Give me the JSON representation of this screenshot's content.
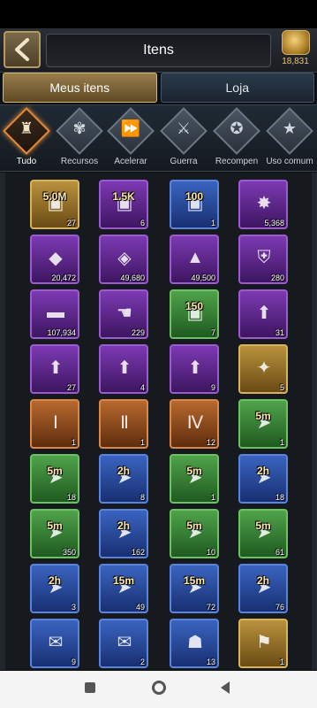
{
  "header": {
    "title": "Itens",
    "gold_amount": "18,831"
  },
  "tabs": [
    {
      "label": "Meus itens",
      "active": true
    },
    {
      "label": "Loja",
      "active": false
    }
  ],
  "categories": [
    {
      "label": "Tudo",
      "icon": "bag-icon",
      "active": true
    },
    {
      "label": "Recursos",
      "icon": "wheat-icon",
      "active": false
    },
    {
      "label": "Acelerar",
      "icon": "fast-forward-icon",
      "active": false
    },
    {
      "label": "Guerra",
      "icon": "crossed-swords-icon",
      "active": false
    },
    {
      "label": "Recompen",
      "icon": "medal-icon",
      "active": false
    },
    {
      "label": "Uso comum",
      "icon": "star-icon",
      "active": false
    }
  ],
  "items": [
    {
      "icon": "gold-chest-icon",
      "rarity": "gold",
      "tag": "5.0M",
      "count": "27"
    },
    {
      "icon": "chest-icon",
      "rarity": "purple",
      "tag": "1.5K",
      "count": "6"
    },
    {
      "icon": "chest-icon",
      "rarity": "blue",
      "tag": "100",
      "count": "1"
    },
    {
      "icon": "badge-icon",
      "rarity": "purple",
      "tag": "",
      "count": "5,368"
    },
    {
      "icon": "crystal-icon",
      "rarity": "purple",
      "tag": "",
      "count": "20,472"
    },
    {
      "icon": "gem-icon",
      "rarity": "purple",
      "tag": "",
      "count": "49,680"
    },
    {
      "icon": "ore-icon",
      "rarity": "purple",
      "tag": "",
      "count": "49,500"
    },
    {
      "icon": "helmet-icon",
      "rarity": "purple",
      "tag": "",
      "count": "280"
    },
    {
      "icon": "stone-icon",
      "rarity": "purple",
      "tag": "",
      "count": "107,934"
    },
    {
      "icon": "rainbow-hand-icon",
      "rarity": "purple",
      "tag": "",
      "count": "229"
    },
    {
      "icon": "chest-icon",
      "rarity": "green",
      "tag": "150",
      "count": "7"
    },
    {
      "icon": "wood-boost-icon",
      "rarity": "purple",
      "tag": "",
      "count": "31"
    },
    {
      "icon": "wheat-boost-icon",
      "rarity": "purple",
      "tag": "",
      "count": "27"
    },
    {
      "icon": "stone-boost-icon",
      "rarity": "purple",
      "tag": "",
      "count": "4"
    },
    {
      "icon": "iron-boost-icon",
      "rarity": "purple",
      "tag": "",
      "count": "9"
    },
    {
      "icon": "cannon-icon",
      "rarity": "gold",
      "tag": "",
      "count": "5"
    },
    {
      "icon": "teleport-i-icon",
      "rarity": "orange",
      "tag": "",
      "count": "1"
    },
    {
      "icon": "teleport-ii-icon",
      "rarity": "orange",
      "tag": "",
      "count": "1"
    },
    {
      "icon": "teleport-iv-icon",
      "rarity": "orange",
      "tag": "",
      "count": "12"
    },
    {
      "icon": "speedup-icon",
      "rarity": "green",
      "tag": "5m",
      "count": "1"
    },
    {
      "icon": "speedup-heal-icon",
      "rarity": "green",
      "tag": "5m",
      "count": "18"
    },
    {
      "icon": "speedup-heal-icon",
      "rarity": "blue",
      "tag": "2h",
      "count": "8"
    },
    {
      "icon": "speedup-build-icon",
      "rarity": "green",
      "tag": "5m",
      "count": "1"
    },
    {
      "icon": "speedup-build-icon",
      "rarity": "blue",
      "tag": "2h",
      "count": "18"
    },
    {
      "icon": "speedup-research-icon",
      "rarity": "green",
      "tag": "5m",
      "count": "350"
    },
    {
      "icon": "speedup-research-icon",
      "rarity": "blue",
      "tag": "2h",
      "count": "162"
    },
    {
      "icon": "speedup-train-icon",
      "rarity": "green",
      "tag": "5m",
      "count": "10"
    },
    {
      "icon": "speedup-train-icon",
      "rarity": "green",
      "tag": "5m",
      "count": "61"
    },
    {
      "icon": "speedup-icon",
      "rarity": "blue",
      "tag": "2h",
      "count": "3"
    },
    {
      "icon": "speedup-icon",
      "rarity": "blue",
      "tag": "15m",
      "count": "49"
    },
    {
      "icon": "speedup-icon",
      "rarity": "blue",
      "tag": "15m",
      "count": "72"
    },
    {
      "icon": "speedup-icon",
      "rarity": "blue",
      "tag": "2h",
      "count": "76"
    },
    {
      "icon": "scroll-icon",
      "rarity": "blue",
      "tag": "",
      "count": "9"
    },
    {
      "icon": "scroll-icon",
      "rarity": "blue",
      "tag": "",
      "count": "2"
    },
    {
      "icon": "warrior-icon",
      "rarity": "blue",
      "tag": "",
      "count": "13"
    },
    {
      "icon": "banner-scroll-icon",
      "rarity": "gold",
      "tag": "",
      "count": "1"
    }
  ]
}
